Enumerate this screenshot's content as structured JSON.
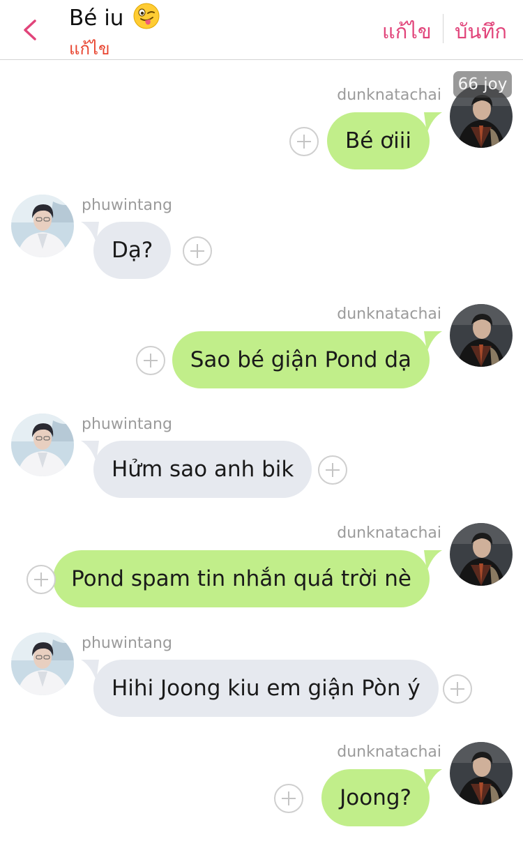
{
  "header": {
    "title": "Bé iu",
    "subtitle": "แก้ไข",
    "edit_label": "แก้ไข",
    "save_label": "บันทึก"
  },
  "overlay_badge": "66 joy",
  "colors": {
    "accent": "#e1447a",
    "subtitle": "#e8442f",
    "bubble_sent": "#c1ee8a",
    "bubble_received": "#e6e9ef"
  },
  "messages": [
    {
      "sender": "dunknatachai",
      "side": "right",
      "text": "Bé ơiii"
    },
    {
      "sender": "phuwintang",
      "side": "left",
      "text": "Dạ?"
    },
    {
      "sender": "dunknatachai",
      "side": "right",
      "text": "Sao bé giận Pond dạ"
    },
    {
      "sender": "phuwintang",
      "side": "left",
      "text": "Hửm sao anh bik"
    },
    {
      "sender": "dunknatachai",
      "side": "right",
      "text": "Pond spam tin nhắn quá trời nè"
    },
    {
      "sender": "phuwintang",
      "side": "left",
      "text": "Hihi Joong kiu em giận Pòn ý"
    },
    {
      "sender": "dunknatachai",
      "side": "right",
      "text": "Joong?"
    }
  ],
  "icons": {
    "back": "chevron-left-icon",
    "add": "plus-circle-icon",
    "title_emoji": "winking-tongue-emoji-icon"
  }
}
